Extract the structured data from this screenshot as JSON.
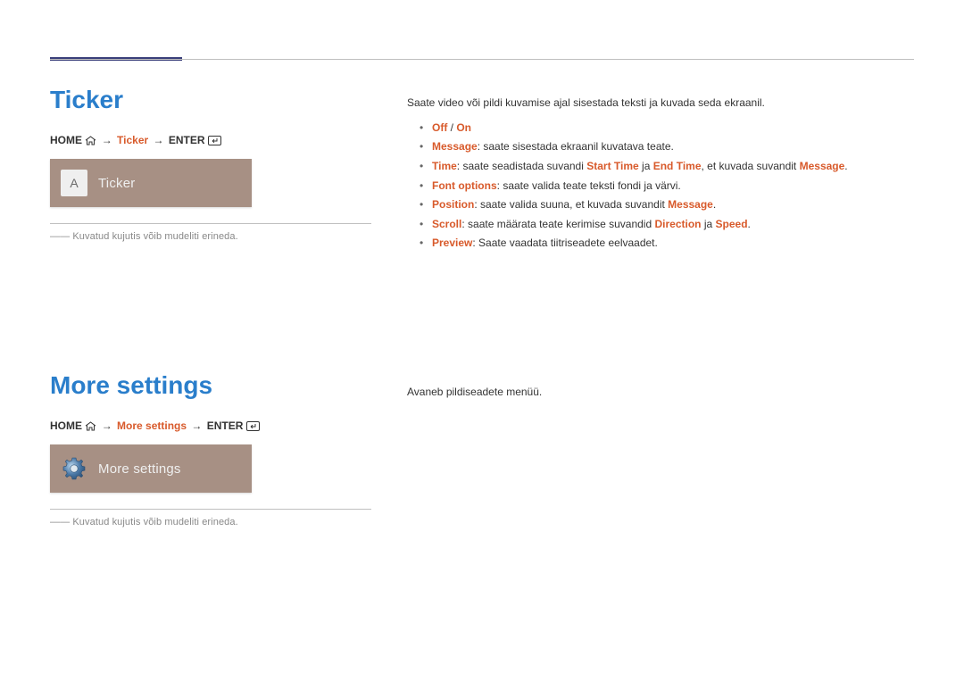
{
  "section1": {
    "title": "Ticker",
    "path": {
      "home": "HOME",
      "step": "Ticker",
      "enter": "ENTER"
    },
    "tile_letter": "A",
    "tile_label": "Ticker",
    "footnote": "――  Kuvatud kujutis võib mudeliti erineda.",
    "intro": "Saate video või pildi kuvamise ajal sisestada teksti ja kuvada seda ekraanil.",
    "bullets": {
      "b1": {
        "off": "Off",
        "slash": " / ",
        "on": "On"
      },
      "b2": {
        "k": "Message",
        "t": ": saate sisestada ekraanil kuvatava teate."
      },
      "b3": {
        "k": "Time",
        "t1": ": saate seadistada suvandi ",
        "s1": "Start Time",
        "t2": " ja ",
        "s2": "End Time",
        "t3": ", et kuvada suvandit ",
        "s3": "Message",
        "t4": "."
      },
      "b4": {
        "k": "Font options",
        "t": ": saate valida teate teksti fondi ja värvi."
      },
      "b5": {
        "k": "Position",
        "t1": ": saate valida suuna, et kuvada suvandit ",
        "s1": "Message",
        "t2": "."
      },
      "b6": {
        "k": "Scroll",
        "t1": ": saate määrata teate kerimise suvandid ",
        "s1": "Direction",
        "t2": " ja ",
        "s2": "Speed",
        "t3": "."
      },
      "b7": {
        "k": "Preview",
        "t": ": Saate vaadata tiitriseadete eelvaadet."
      }
    }
  },
  "section2": {
    "title": "More settings",
    "path": {
      "home": "HOME",
      "step": "More settings",
      "enter": "ENTER"
    },
    "tile_label": "More settings",
    "footnote": "――  Kuvatud kujutis võib mudeliti erineda.",
    "intro": "Avaneb pildiseadete menüü."
  }
}
